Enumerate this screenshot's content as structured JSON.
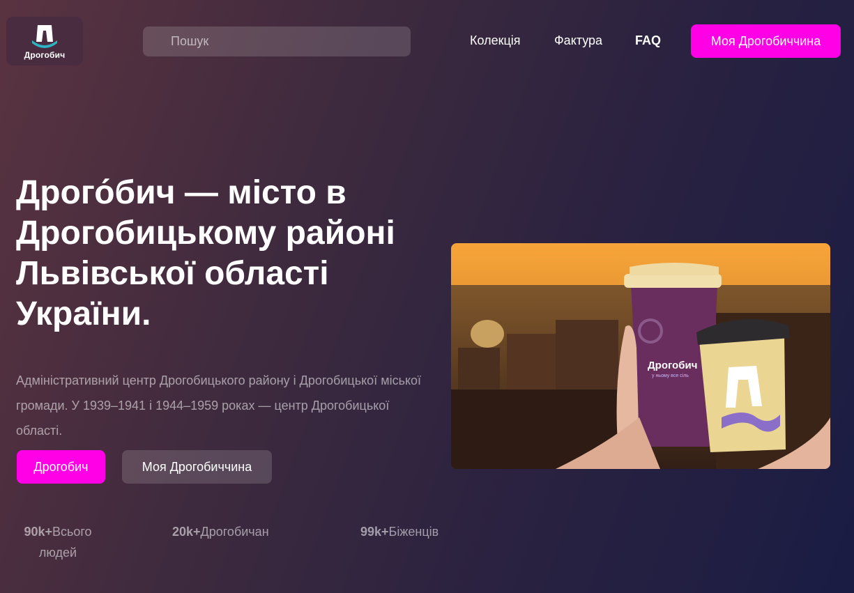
{
  "header": {
    "logo_text": "Дрогобич",
    "search_placeholder": "Пошук",
    "nav": [
      "Колекція",
      "Фактура",
      "FAQ"
    ],
    "cta_label": "Моя Дрогобиччина"
  },
  "hero": {
    "title": "Дрого́бич — місто в Дрогобицькому районі Львівської області України.",
    "description": "Адміністративний центр Дрогобицького району і Дрогобицької міської громади. У 1939–1941 і 1944–1959 роках — центр Дрогобицької області.",
    "primary_button": "Дрогобич",
    "secondary_button": "Моя Дрогобиччина",
    "image_cup_text": "Дрогобич",
    "image_cup_tagline": "у ньому все сіль"
  },
  "stats": [
    {
      "value": "90k+",
      "label": "Всього людей"
    },
    {
      "value": "20k+",
      "label": "Дрогобичан"
    },
    {
      "value": "99k+",
      "label": "Біженців"
    }
  ],
  "colors": {
    "accent": "#ff00e6",
    "logo_teal": "#2fb3c2"
  }
}
